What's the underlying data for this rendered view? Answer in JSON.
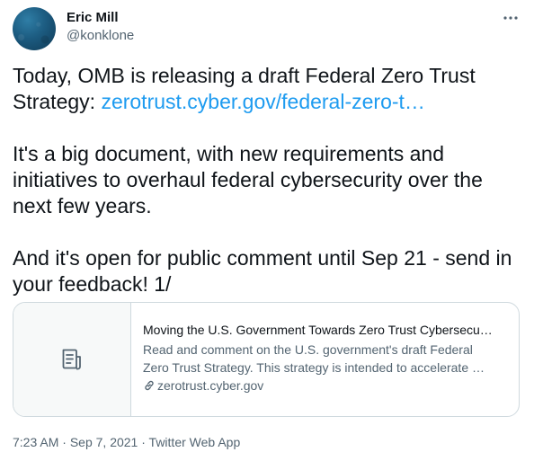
{
  "author": {
    "name": "Eric Mill",
    "handle": "@konklone"
  },
  "tweet": {
    "paragraph1_text": "Today, OMB is releasing a draft Federal Zero Trust Strategy: ",
    "paragraph1_link": "zerotrust.cyber.gov/federal-zero-t…",
    "paragraph2": "It's a big document, with new requirements and initiatives to overhaul federal cybersecurity over the next few years.",
    "paragraph3": "And it's open for public comment until Sep 21 - send in your feedback! 1/"
  },
  "card": {
    "title": "Moving the U.S. Government Towards Zero Trust Cybersecu…",
    "description_line1": "Read and comment on the U.S. government's draft Federal",
    "description_line2": "Zero Trust Strategy. This strategy is intended to accelerate …",
    "domain": "zerotrust.cyber.gov",
    "thumbnail_icon": "document-icon"
  },
  "meta": {
    "time": "7:23 AM",
    "separator1": " · ",
    "date": "Sep 7, 2021",
    "separator2": " · ",
    "app": "Twitter Web App"
  },
  "colors": {
    "link": "#1d9bf0",
    "secondary_text": "#536471",
    "primary_text": "#0f1419",
    "card_border": "#cfd9de"
  }
}
